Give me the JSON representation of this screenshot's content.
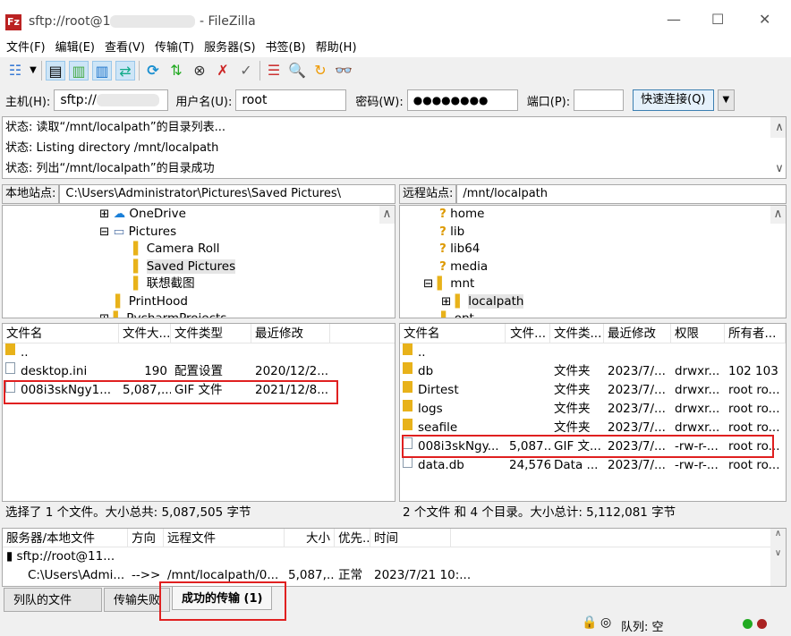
{
  "window": {
    "title_prefix": "sftp://root@1",
    "title_suffix": "- FileZilla",
    "min": "—",
    "max": "☐",
    "close": "✕"
  },
  "menu": [
    "文件(F)",
    "编辑(E)",
    "查看(V)",
    "传输(T)",
    "服务器(S)",
    "书签(B)",
    "帮助(H)"
  ],
  "toolbar": [
    "site-manager",
    "toggle-log",
    "toggle-local-tree",
    "toggle-remote-tree",
    "synchronized-browsing",
    "refresh",
    "process-queue",
    "cancel",
    "disconnect",
    "reconnect",
    "queue-view",
    "search",
    "compare",
    "find"
  ],
  "quickconnect": {
    "host_label": "主机(H):",
    "host_value": "sftp://",
    "user_label": "用户名(U):",
    "user_value": "root",
    "pass_label": "密码(W):",
    "pass_value": "●●●●●●●●",
    "port_label": "端口(P):",
    "port_value": "",
    "connect": "快速连接(Q)"
  },
  "log": [
    {
      "label": "状态:",
      "text": "读取“/mnt/localpath”的目录列表..."
    },
    {
      "label": "状态:",
      "text": "Listing directory /mnt/localpath"
    },
    {
      "label": "状态:",
      "text": "列出“/mnt/localpath”的目录成功"
    }
  ],
  "local": {
    "site_label": "本地站点:",
    "path": "C:\\Users\\Administrator\\Pictures\\Saved Pictures\\",
    "tree": [
      "OneDrive",
      "Pictures",
      "Camera Roll",
      "Saved Pictures",
      "联想截图",
      "PrintHood",
      "PycharmProjects"
    ],
    "headers": [
      "文件名",
      "文件大...",
      "文件类型",
      "最近修改"
    ],
    "files": [
      [
        "..",
        "",
        "",
        ""
      ],
      [
        "desktop.ini",
        "190",
        "配置设置",
        "2020/12/2..."
      ],
      [
        "008i3skNgy1...",
        "5,087,...",
        "GIF 文件",
        "2021/12/8..."
      ]
    ],
    "status": "选择了 1 个文件。大小总共: 5,087,505 字节"
  },
  "remote": {
    "site_label": "远程站点:",
    "path": "/mnt/localpath",
    "tree": [
      "home",
      "lib",
      "lib64",
      "media",
      "mnt",
      "localpath",
      "opt"
    ],
    "headers": [
      "文件名",
      "文件...",
      "文件类...",
      "最近修改",
      "权限",
      "所有者..."
    ],
    "files": [
      [
        "..",
        "",
        "",
        "",
        "",
        ""
      ],
      [
        "db",
        "",
        "文件夹",
        "2023/7/...",
        "drwxr...",
        "102 103"
      ],
      [
        "Dirtest",
        "",
        "文件夹",
        "2023/7/...",
        "drwxr...",
        "root ro..."
      ],
      [
        "logs",
        "",
        "文件夹",
        "2023/7/...",
        "drwxr...",
        "root ro..."
      ],
      [
        "seafile",
        "",
        "文件夹",
        "2023/7/...",
        "drwxr...",
        "root ro..."
      ],
      [
        "008i3skNgy...",
        "5,087...",
        "GIF 文...",
        "2023/7/...",
        "-rw-r-...",
        "root ro..."
      ],
      [
        "data.db",
        "24,576",
        "Data ...",
        "2023/7/...",
        "-rw-r-...",
        "root ro..."
      ]
    ],
    "status": "2 个文件 和 4 个目录。大小总计: 5,112,081 字节"
  },
  "queue": {
    "headers": [
      "服务器/本地文件",
      "方向",
      "远程文件",
      "大小",
      "优先...",
      "时间"
    ],
    "server": "sftp://root@11...",
    "row": [
      "C:\\Users\\Admi...",
      "-->>",
      "/mnt/localpath/0...",
      "5,087,...",
      "正常",
      "2023/7/21 10:..."
    ]
  },
  "tabs": [
    "列队的文件",
    "传输失败",
    "成功的传输 (1)"
  ],
  "statusbar": {
    "queue": "队列: 空"
  }
}
